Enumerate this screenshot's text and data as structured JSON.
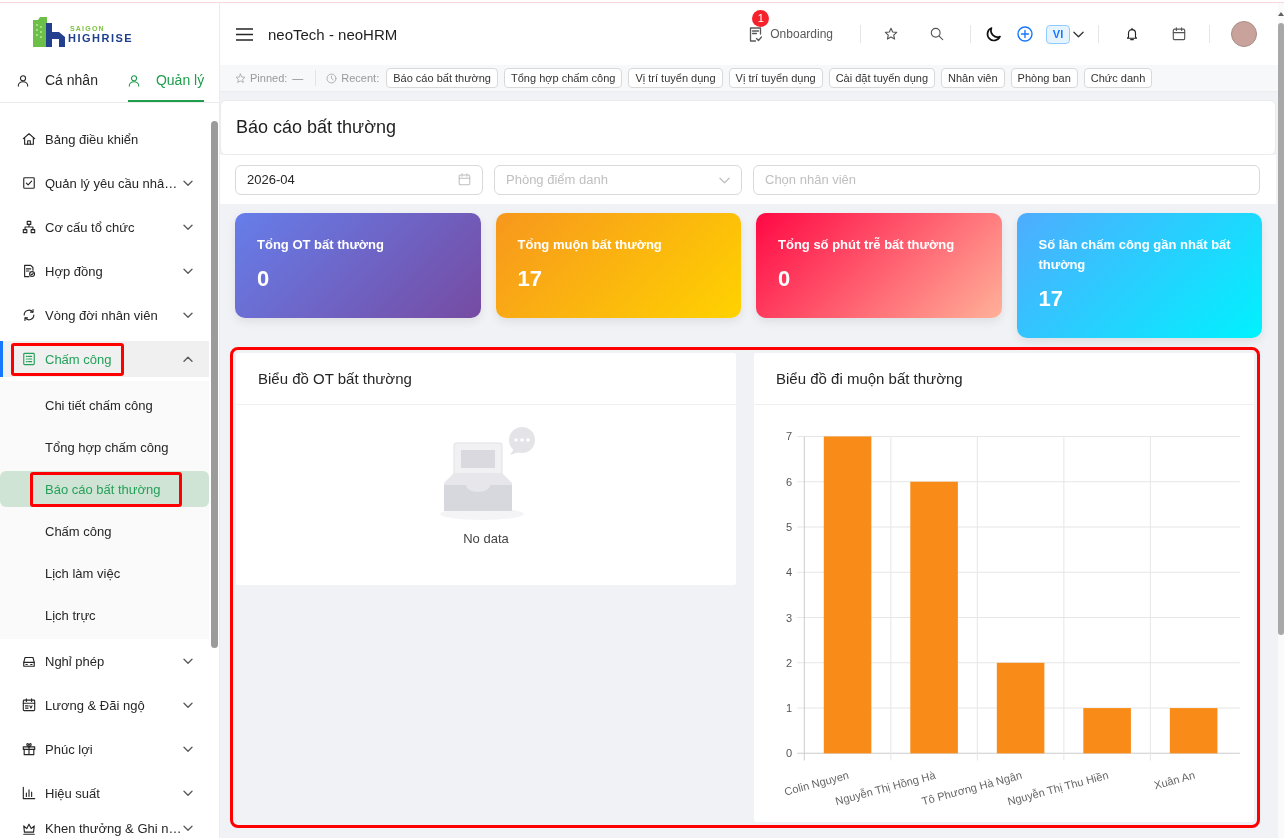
{
  "logo": {
    "line_1": "SAIGON",
    "line_2": "HIGHRISE"
  },
  "sidebar": {
    "tabs": [
      {
        "label": "Cá nhân",
        "selected": false
      },
      {
        "label": "Quản lý",
        "selected": true
      }
    ],
    "items": [
      {
        "label": "Bảng điều khiển",
        "kind": "link",
        "expanded": false,
        "highlighted": false
      },
      {
        "label": "Quản lý yêu cầu nhâ…",
        "kind": "group",
        "expanded": false,
        "highlighted": false
      },
      {
        "label": "Cơ cấu tổ chức",
        "kind": "group",
        "expanded": false,
        "highlighted": false
      },
      {
        "label": "Hợp đồng",
        "kind": "group",
        "expanded": false,
        "highlighted": false
      },
      {
        "label": "Vòng đời nhân viên",
        "kind": "group",
        "expanded": false,
        "highlighted": false
      },
      {
        "label": "Chấm công",
        "kind": "group",
        "expanded": true,
        "highlighted": true,
        "children": [
          {
            "label": "Chi tiết chấm công",
            "selected": false,
            "highlighted": false
          },
          {
            "label": "Tổng hợp chấm công",
            "selected": false,
            "highlighted": false
          },
          {
            "label": "Báo cáo bất thường",
            "selected": true,
            "highlighted": true
          },
          {
            "label": "Chấm công",
            "selected": false,
            "highlighted": false
          },
          {
            "label": "Lịch làm việc",
            "selected": false,
            "highlighted": false
          },
          {
            "label": "Lịch trực",
            "selected": false,
            "highlighted": false
          }
        ]
      },
      {
        "label": "Nghỉ phép",
        "kind": "group",
        "expanded": false,
        "highlighted": false
      },
      {
        "label": "Lương & Đãi ngộ",
        "kind": "group",
        "expanded": false,
        "highlighted": false
      },
      {
        "label": "Phúc lợi",
        "kind": "group",
        "expanded": false,
        "highlighted": false
      },
      {
        "label": "Hiệu suất",
        "kind": "group",
        "expanded": false,
        "highlighted": false
      },
      {
        "label": "Khen thưởng & Ghi n…",
        "kind": "group",
        "expanded": false,
        "highlighted": false
      }
    ]
  },
  "header": {
    "title": "neoTech - neoHRM",
    "onboarding": {
      "label": "Onboarding",
      "badge": "1"
    },
    "language": "VI"
  },
  "quick_bar": {
    "pinned_label": "Pinned:",
    "pinned_value": "—",
    "recent_label": "Recent:",
    "recent": [
      "Báo cáo bất thường",
      "Tổng hợp chấm công",
      "Vị trí tuyển dụng",
      "Vị trí tuyển dụng",
      "Cài đặt tuyển dụng",
      "Nhân viên",
      "Phòng ban",
      "Chức danh"
    ]
  },
  "page": {
    "title": "Báo cáo bất thường",
    "filters": [
      {
        "kind": "date",
        "value": "2026-04"
      },
      {
        "kind": "select",
        "placeholder": "Phòng điểm danh"
      },
      {
        "kind": "text",
        "placeholder": "Chọn nhân viên"
      }
    ],
    "stats": [
      {
        "label": "Tổng OT bất thường",
        "value": "0"
      },
      {
        "label": "Tổng muộn bất thường",
        "value": "17"
      },
      {
        "label": "Tổng số phút trễ bất thường",
        "value": "0"
      },
      {
        "label": "Số lần chấm công gần nhất bất thường",
        "value": "17"
      }
    ],
    "charts": {
      "highlighted": true,
      "panels": [
        {
          "kind": "empty",
          "title": "Biểu đồ OT bất thường",
          "message": "No data"
        },
        {
          "kind": "chart",
          "title": "Biểu đồ đi muộn bất thường",
          "chart_data": {
            "type": "bar",
            "categories": [
              "Colin Nguyen",
              "Nguyễn Thị Hồng Hà",
              "Tô Phương Hà Ngân",
              "Nguyễn Thị Thu Hiền",
              "Xuân An"
            ],
            "series": [
              {
                "color": "#f98c18",
                "values": [
                  7,
                  6,
                  2,
                  1,
                  1
                ]
              }
            ],
            "ylim": [
              0,
              7
            ],
            "yticks": [
              0,
              1,
              2,
              3,
              4,
              5,
              6,
              7
            ],
            "grid": true
          }
        }
      ]
    }
  }
}
